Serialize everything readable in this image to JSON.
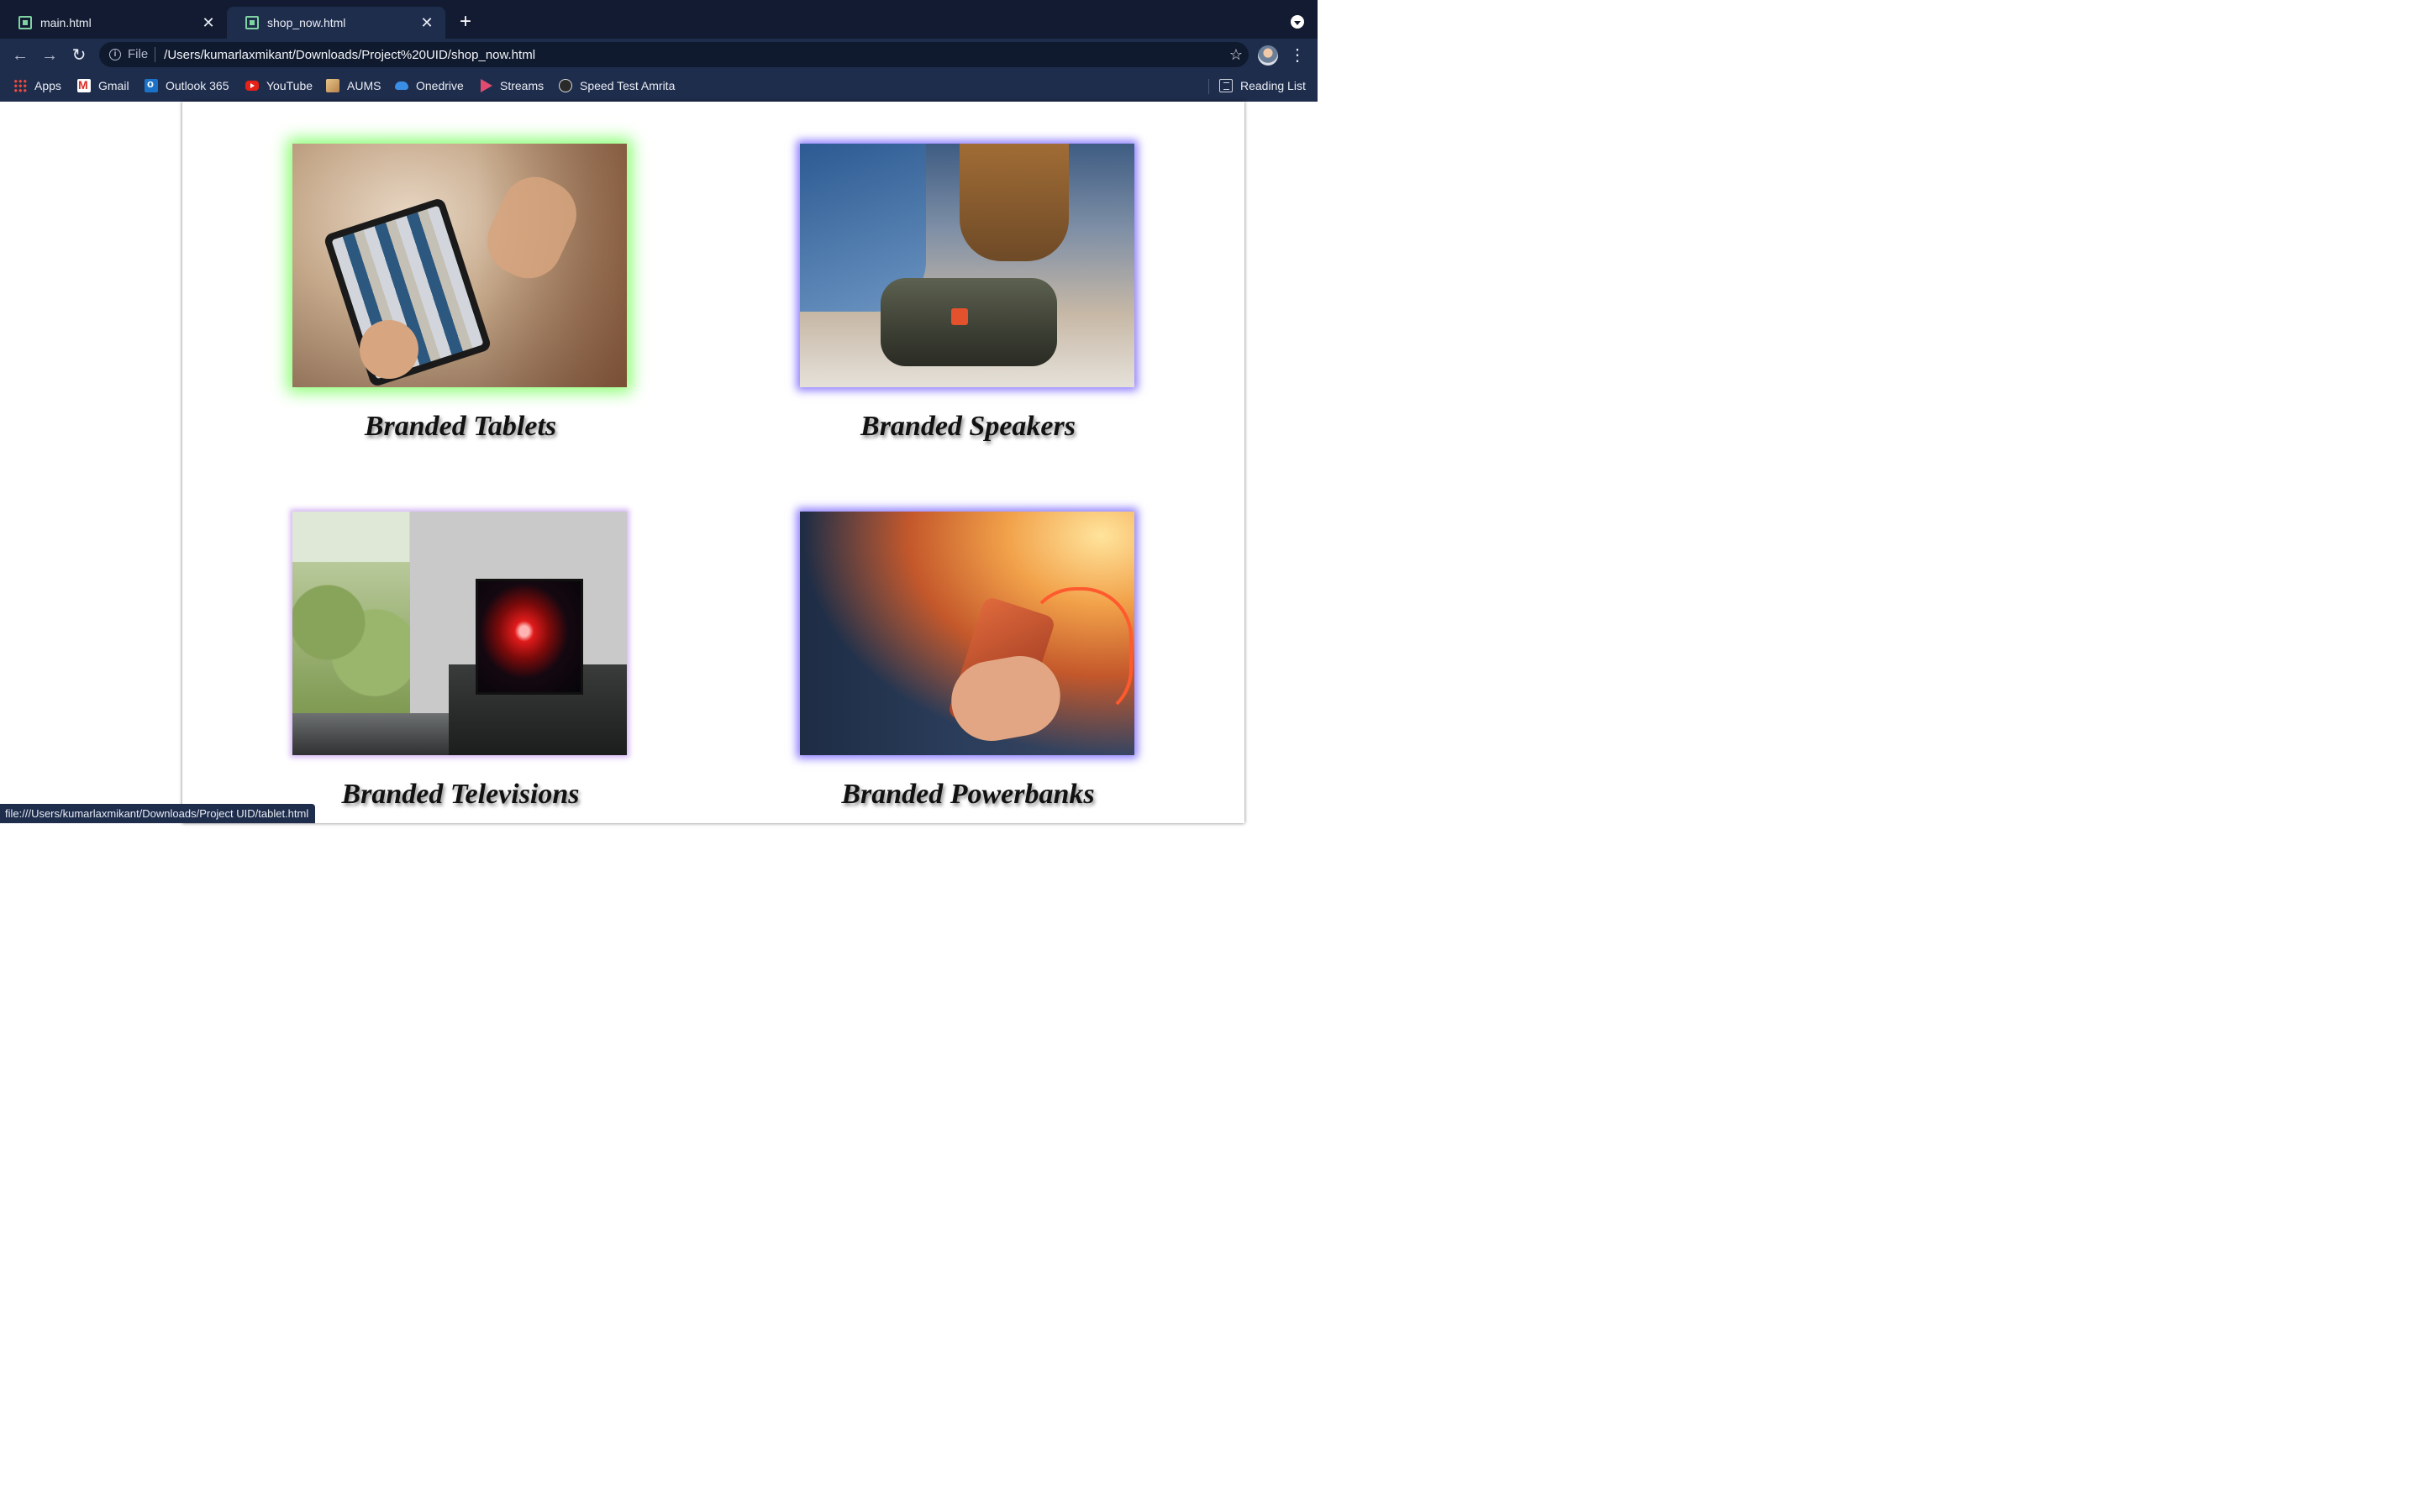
{
  "browser": {
    "tabs": [
      {
        "title": "main.html",
        "active": false
      },
      {
        "title": "shop_now.html",
        "active": true
      }
    ],
    "address": {
      "scheme_label": "File",
      "url": "/Users/kumarlaxmikant/Downloads/Project%20UID/shop_now.html"
    },
    "bookmarks": [
      {
        "label": "Apps",
        "icon": "apps-grid-icon"
      },
      {
        "label": "Gmail",
        "icon": "gmail-icon"
      },
      {
        "label": "Outlook 365",
        "icon": "outlook-icon"
      },
      {
        "label": "YouTube",
        "icon": "youtube-icon"
      },
      {
        "label": "AUMS",
        "icon": "aums-icon"
      },
      {
        "label": "Onedrive",
        "icon": "onedrive-icon"
      },
      {
        "label": "Streams",
        "icon": "streams-icon"
      },
      {
        "label": "Speed Test Amrita",
        "icon": "speedtest-icon"
      }
    ],
    "reading_list": "Reading List",
    "status_url": "file:///Users/kumarlaxmikant/Downloads/Project UID/tablet.html"
  },
  "products": [
    {
      "caption": "Branded Tablets",
      "glow": "#8bff74"
    },
    {
      "caption": "Branded Speakers",
      "glow": "#8d7dff"
    },
    {
      "caption": "Branded Televisions",
      "glow": "#d6b8f4"
    },
    {
      "caption": "Branded Powerbanks",
      "glow": "#8d7dff"
    }
  ],
  "colors": {
    "chrome_tabstrip": "#121b31",
    "chrome_toolbar": "#1f2d4d",
    "page_background": "#ffffff"
  }
}
